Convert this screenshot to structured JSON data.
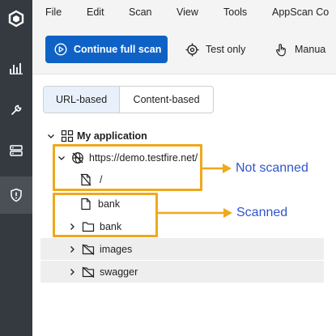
{
  "menubar": {
    "items": [
      "File",
      "Edit",
      "Scan",
      "View",
      "Tools",
      "AppScan Co"
    ]
  },
  "toolbar": {
    "primary_label": "Continue full scan",
    "test_only_label": "Test only",
    "manual_label": "Manua"
  },
  "view_toggle": {
    "options": [
      "URL-based",
      "Content-based"
    ],
    "selected": "URL-based"
  },
  "tree": {
    "root": "My application",
    "site": "https://demo.testfire.net/",
    "nodes": [
      "/",
      "bank",
      "bank",
      "images",
      "swagger"
    ]
  },
  "annotations": {
    "not_scanned": "Not scanned",
    "scanned": "Scanned"
  },
  "colors": {
    "rail": "#343a40",
    "primary": "#0f62c5",
    "annotation_border": "#f0a81c",
    "annotation_text": "#2f57c9",
    "toggle_selected": "#e8f1fb"
  }
}
